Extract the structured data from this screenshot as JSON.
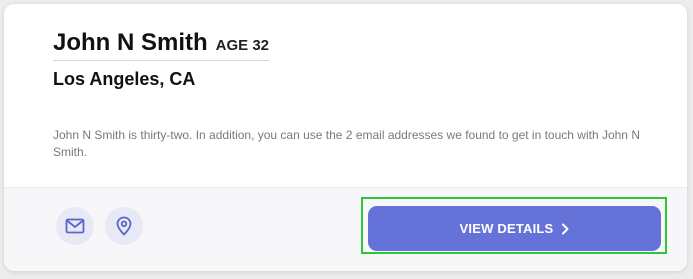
{
  "person": {
    "name": "John N Smith",
    "age_label": "AGE 32",
    "location": "Los Angeles, CA",
    "description": "John N Smith is thirty-two. In addition, you can use the 2 email addresses we found to get in touch with John N Smith."
  },
  "actions": {
    "email_icon": "envelope-icon",
    "location_icon": "map-pin-icon",
    "view_details_label": "VIEW DETAILS",
    "view_details_icon": "chevron-right-icon"
  },
  "colors": {
    "accent": "#6573d9",
    "icon_bg": "#e7e9f6",
    "highlight": "#2fc43b"
  }
}
